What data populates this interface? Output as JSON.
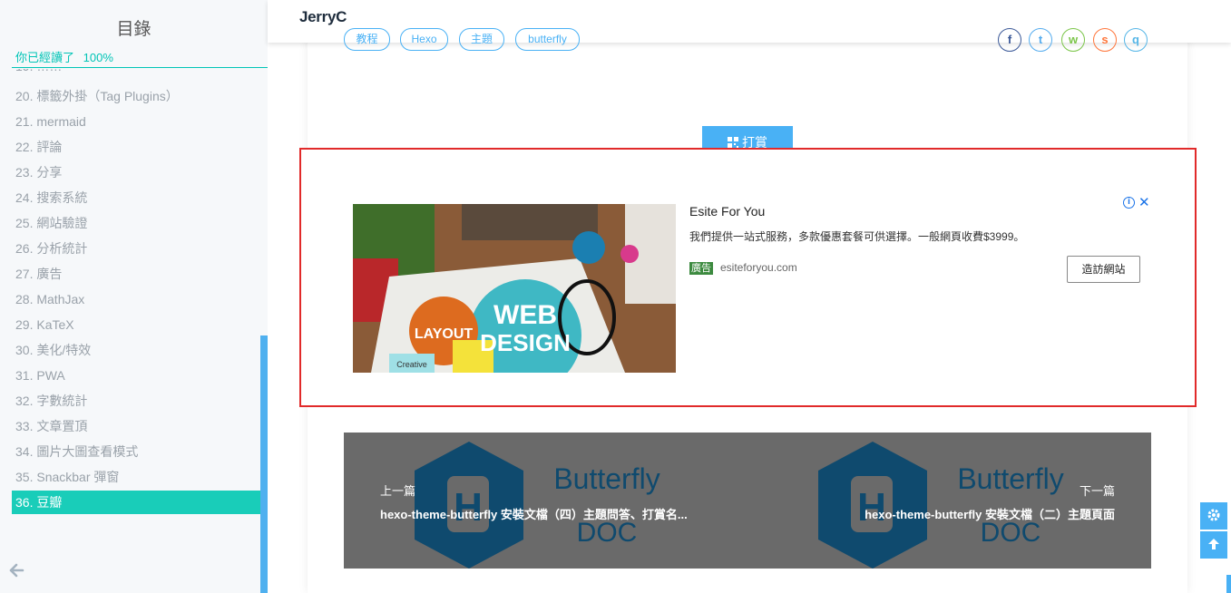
{
  "site": {
    "name": "JerryC"
  },
  "toc": {
    "title": "目錄",
    "progress_label": "你已經讀了",
    "progress_value": "100%",
    "items": [
      "20. 標籤外掛（Tag Plugins）",
      "21. mermaid",
      "22. 評論",
      "23. 分享",
      "24. 搜索系統",
      "25. 網站驗證",
      "26. 分析統計",
      "27. 廣告",
      "28. MathJax",
      "29. KaTeX",
      "30. 美化/特效",
      "31. PWA",
      "32. 字數統計",
      "33. 文章置頂",
      "34. 圖片大圖查看模式",
      "35. Snackbar 彈窗",
      "36. 豆瓣"
    ],
    "active_index": 16
  },
  "tags": [
    "教程",
    "Hexo",
    "主題",
    "butterfly"
  ],
  "share_icons": [
    "facebook-icon",
    "twitter-icon",
    "wechat-icon",
    "weibo-icon",
    "qq-icon"
  ],
  "reward": {
    "label": "打賞",
    "icon": "qrcode-icon"
  },
  "ad": {
    "title": "Esite For You",
    "description": "我們提供一站式服務，多款優惠套餐可供選擇。一般網頁收費$3999。",
    "badge": "廣告",
    "domain": "esiteforyou.com",
    "visit_label": "造訪網站",
    "image_words": {
      "top": "WEB",
      "bottom": "DESIGN",
      "left": "LAYOUT",
      "note": "Creative"
    }
  },
  "pagination": {
    "prev": {
      "label": "上一篇",
      "title": "hexo-theme-butterfly 安裝文檔（四）主題問答、打賞名..."
    },
    "next": {
      "label": "下一篇",
      "title": "hexo-theme-butterfly 安裝文檔（二）主題頁面"
    },
    "cover_words": {
      "brand": "Butterfly",
      "sub": "DOC",
      "letter": "H"
    }
  },
  "colors": {
    "accent": "#49b1f5",
    "toc_active": "#19cdb9",
    "ad_border": "#e12a2a"
  }
}
